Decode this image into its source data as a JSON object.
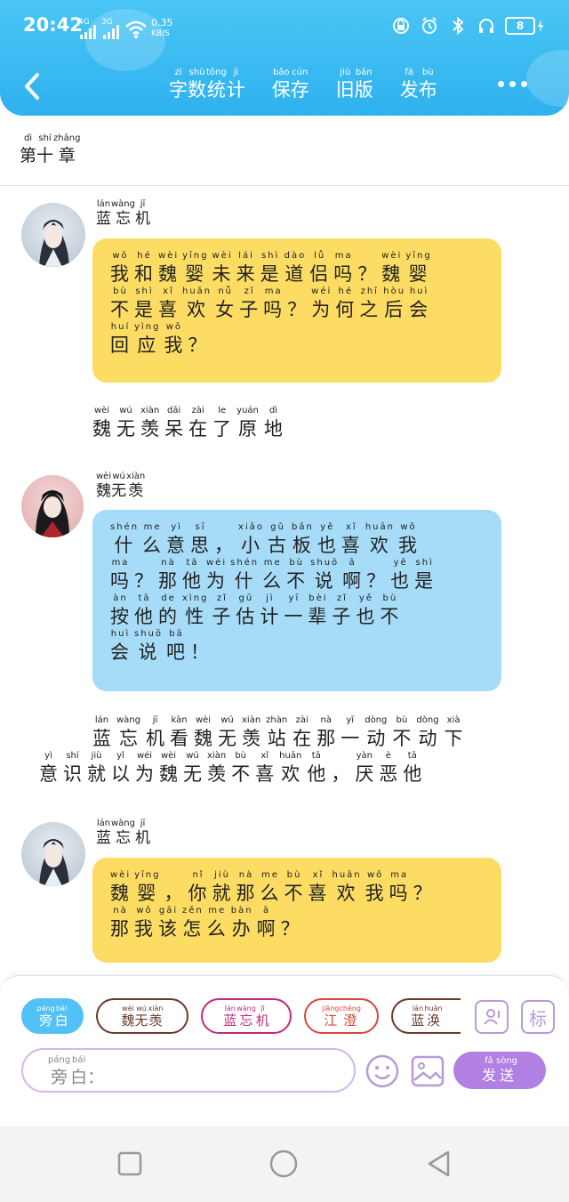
{
  "status": {
    "time": "20:42",
    "net1": "4G",
    "net2": "3G",
    "speed_value": "0.35",
    "speed_unit": "KB/S",
    "battery": "8"
  },
  "colors": {
    "header": "#3bbcf2",
    "yellow": "#fddc64",
    "blue": "#a7dcf8",
    "accent": "#b27fe3"
  },
  "toolbar": [
    {
      "py": [
        "zì",
        "shù",
        "tǒng",
        "jì"
      ],
      "hz": [
        "字",
        "数",
        "统",
        "计"
      ]
    },
    {
      "py": [
        "bǎo",
        "cún"
      ],
      "hz": [
        "保",
        "存"
      ]
    },
    {
      "py": [
        "jiù",
        "bǎn"
      ],
      "hz": [
        "旧",
        "版"
      ]
    },
    {
      "py": [
        "fā",
        "bù"
      ],
      "hz": [
        "发",
        "布"
      ]
    }
  ],
  "chapter": {
    "py": [
      "dì",
      "shí",
      "zhāng"
    ],
    "hz": [
      "第",
      "十",
      "章"
    ]
  },
  "messages": [
    {
      "speaker": {
        "py": [
          "lán",
          "wàng",
          "jī"
        ],
        "hz": [
          "蓝",
          "忘",
          "机"
        ]
      },
      "lines": [
        {
          "py": [
            "wǒ",
            "hé",
            "wèi",
            "yīng",
            "wèi",
            "lái",
            "shì",
            "dào",
            "lǚ",
            "ma",
            "",
            "wèi",
            "yīng"
          ],
          "hz": [
            "我",
            "和",
            "魏",
            "婴",
            "未",
            "来",
            "是",
            "道",
            "侣",
            "吗",
            "？",
            "魏",
            "婴"
          ]
        },
        {
          "py": [
            "bù",
            "shì",
            "xǐ",
            "huān",
            "nǚ",
            "zǐ",
            "ma",
            "",
            "wéi",
            "hé",
            "zhī",
            "hòu",
            "huì"
          ],
          "hz": [
            "不",
            "是",
            "喜",
            "欢",
            "女",
            "子",
            "吗",
            "？",
            "为",
            "何",
            "之",
            "后",
            "会"
          ]
        },
        {
          "py": [
            "huí",
            "yìng",
            "wǒ",
            ""
          ],
          "hz": [
            "回",
            "应",
            "我",
            "？"
          ]
        }
      ]
    },
    {
      "speaker": {
        "py": [
          "wèi",
          "wú",
          "xiàn"
        ],
        "hz": [
          "魏",
          "无",
          "羡"
        ]
      },
      "lines": [
        {
          "py": [
            "shén",
            "me",
            "yì",
            "sī",
            "",
            "xiǎo",
            "gǔ",
            "bǎn",
            "yě",
            "xǐ",
            "huān",
            "wǒ"
          ],
          "hz": [
            "什",
            "么",
            "意",
            "思",
            "，",
            "小",
            "古",
            "板",
            "也",
            "喜",
            "欢",
            "我"
          ]
        },
        {
          "py": [
            "ma",
            "",
            "nà",
            "tā",
            "wéi",
            "shén",
            "me",
            "bù",
            "shuō",
            "ā",
            "",
            "yě",
            "shì"
          ],
          "hz": [
            "吗",
            "？",
            "那",
            "他",
            "为",
            "什",
            "么",
            "不",
            "说",
            "啊",
            "？",
            "也",
            "是"
          ]
        },
        {
          "py": [
            "àn",
            "tā",
            "de",
            "xìng",
            "zǐ",
            "gū",
            "jì",
            "yī",
            "bèi",
            "zǐ",
            "yě",
            "bù"
          ],
          "hz": [
            "按",
            "他",
            "的",
            "性",
            "子",
            "估",
            "计",
            "一",
            "辈",
            "子",
            "也",
            "不"
          ]
        },
        {
          "py": [
            "huì",
            "shuō",
            "bā",
            ""
          ],
          "hz": [
            "会",
            "说",
            "吧",
            "！"
          ]
        }
      ]
    },
    {
      "speaker": {
        "py": [
          "lán",
          "wàng",
          "jī"
        ],
        "hz": [
          "蓝",
          "忘",
          "机"
        ]
      },
      "lines": [
        {
          "py": [
            "wèi",
            "yīng",
            "",
            "nǐ",
            "jiù",
            "nà",
            "me",
            "bù",
            "xǐ",
            "huān",
            "wǒ",
            "ma",
            ""
          ],
          "hz": [
            "魏",
            "婴",
            "，",
            "你",
            "就",
            "那",
            "么",
            "不",
            "喜",
            "欢",
            "我",
            "吗",
            "？"
          ]
        },
        {
          "py": [
            "nà",
            "wǒ",
            "gāi",
            "zěn",
            "me",
            "bàn",
            "ā",
            ""
          ],
          "hz": [
            "那",
            "我",
            "该",
            "怎",
            "么",
            "办",
            "啊",
            "？"
          ]
        }
      ]
    }
  ],
  "narrations": [
    {
      "lines": [
        {
          "py": [
            "wèi",
            "wú",
            "xiàn",
            "dāi",
            "zài",
            "le",
            "yuán",
            "dì"
          ],
          "hz": [
            "魏",
            "无",
            "羡",
            "呆",
            "在",
            "了",
            "原",
            "地"
          ]
        }
      ]
    },
    {
      "lines": [
        {
          "py": [
            "lán",
            "wàng",
            "jī",
            "kàn",
            "wèi",
            "wú",
            "xiàn",
            "zhàn",
            "zài",
            "nà",
            "yī",
            "dòng",
            "bù",
            "dòng",
            "xià"
          ],
          "hz": [
            "蓝",
            "忘",
            "机",
            "看",
            "魏",
            "无",
            "羡",
            "站",
            "在",
            "那",
            "一",
            "动",
            "不",
            "动",
            "下"
          ]
        },
        {
          "py": [
            "yì",
            "shí",
            "jiù",
            "yǐ",
            "wéi",
            "wèi",
            "wú",
            "xiàn",
            "bù",
            "xǐ",
            "huān",
            "tā",
            "",
            "yàn",
            "è",
            "tā"
          ],
          "hz": [
            "意",
            "识",
            "就",
            "以",
            "为",
            "魏",
            "无",
            "羡",
            "不",
            "喜",
            "欢",
            "他",
            "，",
            "厌",
            "恶",
            "他"
          ]
        }
      ]
    }
  ],
  "chips": [
    {
      "py": [
        "páng",
        "bái"
      ],
      "hz": [
        "旁",
        "白"
      ],
      "active": true
    },
    {
      "py": [
        "wèi",
        "wú",
        "xiàn"
      ],
      "hz": [
        "魏",
        "无",
        "羡"
      ]
    },
    {
      "py": [
        "lán",
        "wàng",
        "jī"
      ],
      "hz": [
        "蓝",
        "忘",
        "机"
      ]
    },
    {
      "py": [
        "jiāng",
        "chéng"
      ],
      "hz": [
        "江",
        "澄"
      ]
    },
    {
      "py": [
        "lán",
        "huàn"
      ],
      "hz": [
        "蓝",
        "涣"
      ]
    }
  ],
  "tag_button_label": "标",
  "input_placeholder": {
    "py": [
      "páng",
      "bái",
      ""
    ],
    "hz": [
      "旁",
      "白",
      "："
    ]
  },
  "send": {
    "py": [
      "fā",
      "sòng"
    ],
    "hz": [
      "发",
      "送"
    ]
  }
}
